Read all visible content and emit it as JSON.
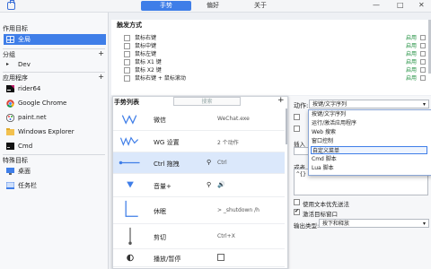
{
  "window": {
    "tabs": [
      "手势",
      "偏好",
      "关于"
    ],
    "controls": [
      "—",
      "□",
      "✕"
    ]
  },
  "sidebar": {
    "scope_title": "作用目标",
    "global_label": "全局",
    "group_title": "分组",
    "group_item": "Dev",
    "apps_title": "应用程序",
    "apps": [
      "rider64",
      "Google Chrome",
      "paint.net",
      "Windows Explorer",
      "Cmd"
    ],
    "special_title": "特殊目标",
    "special": [
      "桌面",
      "任务栏"
    ],
    "add_symbol": "+"
  },
  "triggers": {
    "title": "触发方式",
    "rows": [
      {
        "label": "鼠标右键",
        "status": "启用"
      },
      {
        "label": "鼠标中键",
        "status": "启用"
      },
      {
        "label": "鼠标左键",
        "status": "启用"
      },
      {
        "label": "鼠标 X1 键",
        "status": "启用"
      },
      {
        "label": "鼠标 X2 键",
        "status": "启用"
      },
      {
        "label": "鼠标右键 + 鼠标滚动",
        "status": "启用"
      }
    ]
  },
  "gestures": {
    "title": "手势列表",
    "search_placeholder": "搜索",
    "add_symbol": "+",
    "rows": [
      {
        "name": "微信",
        "hotkey": "WeChat.exe"
      },
      {
        "name": "WG 设置",
        "hotkey": "2 个动作"
      },
      {
        "name": "Ctrl 拖拽",
        "hotkey": "Ctrl"
      },
      {
        "name": "音量+",
        "hotkey": ""
      },
      {
        "name": "休眠",
        "hotkey": "> _shutdown /h"
      },
      {
        "name": "剪切",
        "hotkey": "Ctrl+X"
      },
      {
        "name": "播放/暂停",
        "hotkey": ""
      }
    ]
  },
  "action": {
    "label": "动作:",
    "selected": "按键/文字序列",
    "options": [
      "按键/文字序列",
      "运行/激活应用程序",
      "Web 搜索",
      "窗口控制",
      "自定义菜单",
      "Cmd 脚本",
      "Lua 脚本"
    ],
    "insert_label": "插入",
    "or_label": "或者",
    "expr": "^{}",
    "text_input_label": "使用文本优先送法",
    "activate_label": "激活目标窗口",
    "output_label": "输出类型:",
    "output_value": "按下和释放",
    "arrow": "▾"
  }
}
